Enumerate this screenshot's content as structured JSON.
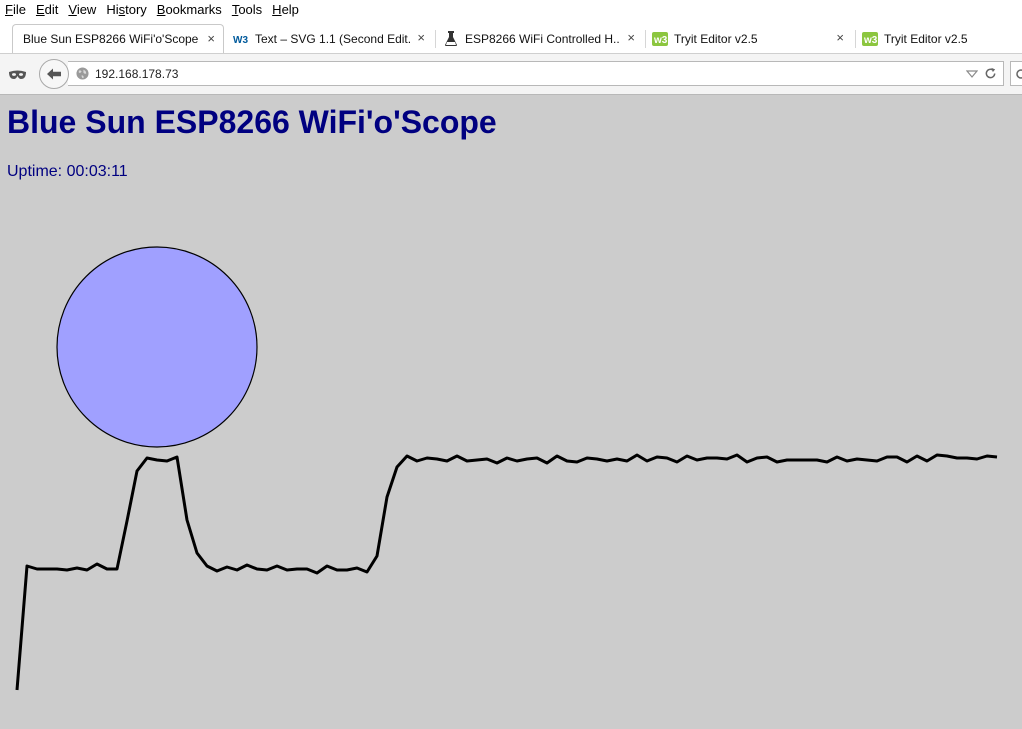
{
  "menu": [
    {
      "label": "File",
      "key": "F",
      "rest": "ile"
    },
    {
      "label": "Edit",
      "key": "E",
      "rest": "dit"
    },
    {
      "label": "View",
      "key": "V",
      "rest": "iew"
    },
    {
      "label": "History",
      "key": "",
      "pre": "Hi",
      "ukey": "s",
      "rest": "tory"
    },
    {
      "label": "Bookmarks",
      "key": "B",
      "rest": "ookmarks"
    },
    {
      "label": "Tools",
      "key": "T",
      "rest": "ools"
    },
    {
      "label": "Help",
      "key": "H",
      "rest": "elp"
    }
  ],
  "tabs": [
    {
      "label": "Blue Sun ESP8266 WiFi'o'Scope",
      "icon": "none"
    },
    {
      "label": "Text – SVG 1.1 (Second Edit...",
      "icon": "w3c-icon"
    },
    {
      "label": "ESP8266 WiFi Controlled H...",
      "icon": "flask-icon"
    },
    {
      "label": "Tryit Editor v2.5",
      "icon": "w3schools-icon"
    },
    {
      "label": "Tryit Editor v2.5",
      "icon": "w3schools-icon"
    }
  ],
  "tab_close_glyph": "×",
  "address": {
    "url": "192.168.178.73"
  },
  "page": {
    "title": "Blue Sun ESP8266 WiFi'o'Scope",
    "uptime_label": "Uptime:",
    "uptime_value": "00:03:11"
  },
  "indicator": {
    "fill_color": "#a0a0ff",
    "stroke_color": "#000000"
  },
  "trace": {
    "stroke_color": "#000000",
    "points": [
      [
        17,
        690
      ],
      [
        27,
        566
      ],
      [
        37,
        569
      ],
      [
        47,
        569
      ],
      [
        57,
        569
      ],
      [
        67,
        570
      ],
      [
        77,
        568
      ],
      [
        87,
        570
      ],
      [
        97,
        564
      ],
      [
        107,
        569
      ],
      [
        117,
        569
      ],
      [
        127,
        521
      ],
      [
        137,
        471
      ],
      [
        147,
        458
      ],
      [
        157,
        460
      ],
      [
        167,
        461
      ],
      [
        177,
        457
      ],
      [
        187,
        520
      ],
      [
        197,
        553
      ],
      [
        207,
        566
      ],
      [
        217,
        571
      ],
      [
        227,
        567
      ],
      [
        237,
        570
      ],
      [
        247,
        565
      ],
      [
        257,
        569
      ],
      [
        267,
        570
      ],
      [
        277,
        566
      ],
      [
        287,
        570
      ],
      [
        297,
        569
      ],
      [
        307,
        569
      ],
      [
        317,
        573
      ],
      [
        327,
        566
      ],
      [
        337,
        570
      ],
      [
        347,
        570
      ],
      [
        357,
        568
      ],
      [
        367,
        572
      ],
      [
        377,
        556
      ],
      [
        387,
        497
      ],
      [
        397,
        467
      ],
      [
        407,
        456
      ],
      [
        417,
        461
      ],
      [
        427,
        458
      ],
      [
        437,
        459
      ],
      [
        447,
        461
      ],
      [
        457,
        456
      ],
      [
        467,
        461
      ],
      [
        477,
        460
      ],
      [
        487,
        459
      ],
      [
        497,
        463
      ],
      [
        507,
        458
      ],
      [
        517,
        461
      ],
      [
        527,
        459
      ],
      [
        537,
        458
      ],
      [
        547,
        463
      ],
      [
        557,
        456
      ],
      [
        567,
        461
      ],
      [
        577,
        462
      ],
      [
        587,
        458
      ],
      [
        597,
        459
      ],
      [
        607,
        461
      ],
      [
        617,
        459
      ],
      [
        627,
        461
      ],
      [
        637,
        455
      ],
      [
        647,
        461
      ],
      [
        657,
        457
      ],
      [
        667,
        458
      ],
      [
        677,
        462
      ],
      [
        687,
        456
      ],
      [
        697,
        460
      ],
      [
        707,
        458
      ],
      [
        717,
        458
      ],
      [
        727,
        459
      ],
      [
        737,
        455
      ],
      [
        747,
        462
      ],
      [
        757,
        458
      ],
      [
        767,
        457
      ],
      [
        777,
        462
      ],
      [
        787,
        460
      ],
      [
        797,
        460
      ],
      [
        807,
        460
      ],
      [
        817,
        460
      ],
      [
        827,
        462
      ],
      [
        837,
        457
      ],
      [
        847,
        461
      ],
      [
        857,
        459
      ],
      [
        867,
        460
      ],
      [
        877,
        461
      ],
      [
        887,
        457
      ],
      [
        897,
        457
      ],
      [
        907,
        462
      ],
      [
        917,
        456
      ],
      [
        927,
        461
      ],
      [
        937,
        455
      ],
      [
        947,
        456
      ],
      [
        957,
        458
      ],
      [
        967,
        458
      ],
      [
        977,
        459
      ],
      [
        987,
        456
      ],
      [
        997,
        457
      ]
    ]
  }
}
